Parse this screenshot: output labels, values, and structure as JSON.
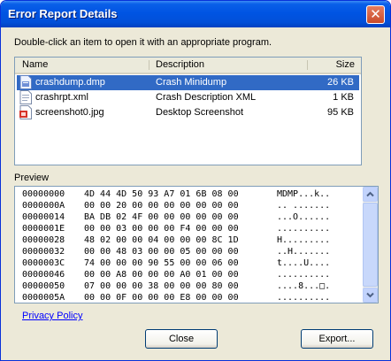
{
  "window": {
    "title": "Error Report Details",
    "close_glyph": "✕"
  },
  "instructions": "Double-click an item to open it with an appropriate program.",
  "file_list": {
    "columns": [
      "Name",
      "Description",
      "Size"
    ],
    "rows": [
      {
        "icon": "dump-file-icon",
        "name": "crashdump.dmp",
        "description": "Crash Minidump",
        "size": "26 KB",
        "selected": true
      },
      {
        "icon": "xml-file-icon",
        "name": "crashrpt.xml",
        "description": "Crash Description XML",
        "size": "1 KB",
        "selected": false
      },
      {
        "icon": "image-file-icon",
        "name": "screenshot0.jpg",
        "description": "Desktop Screenshot",
        "size": "95 KB",
        "selected": false
      }
    ]
  },
  "preview": {
    "label": "Preview",
    "rows": [
      {
        "offset": "00000000",
        "hex": "4D 44 4D 50 93 A7 01 6B 08 00",
        "ascii": "MDMP...k.."
      },
      {
        "offset": "0000000A",
        "hex": "00 00 20 00 00 00 00 00 00 00",
        "ascii": ".. ......."
      },
      {
        "offset": "00000014",
        "hex": "BA DB 02 4F 00 00 00 00 00 00",
        "ascii": "...O......"
      },
      {
        "offset": "0000001E",
        "hex": "00 00 03 00 00 00 F4 00 00 00",
        "ascii": ".........."
      },
      {
        "offset": "00000028",
        "hex": "48 02 00 00 04 00 00 00 8C 1D",
        "ascii": "H........."
      },
      {
        "offset": "00000032",
        "hex": "00 00 48 03 00 00 05 00 00 00",
        "ascii": "..H......."
      },
      {
        "offset": "0000003C",
        "hex": "74 00 00 00 90 55 00 00 06 00",
        "ascii": "t....U...."
      },
      {
        "offset": "00000046",
        "hex": "00 00 A8 00 00 00 A0 01 00 00",
        "ascii": ".........."
      },
      {
        "offset": "00000050",
        "hex": "07 00 00 00 38 00 00 00 80 00",
        "ascii": "....8...□."
      },
      {
        "offset": "0000005A",
        "hex": "00 00 0F 00 00 00 E8 00 00 00",
        "ascii": ".........."
      }
    ]
  },
  "links": {
    "privacy": "Privacy Policy"
  },
  "buttons": {
    "close": "Close",
    "export": "Export..."
  }
}
